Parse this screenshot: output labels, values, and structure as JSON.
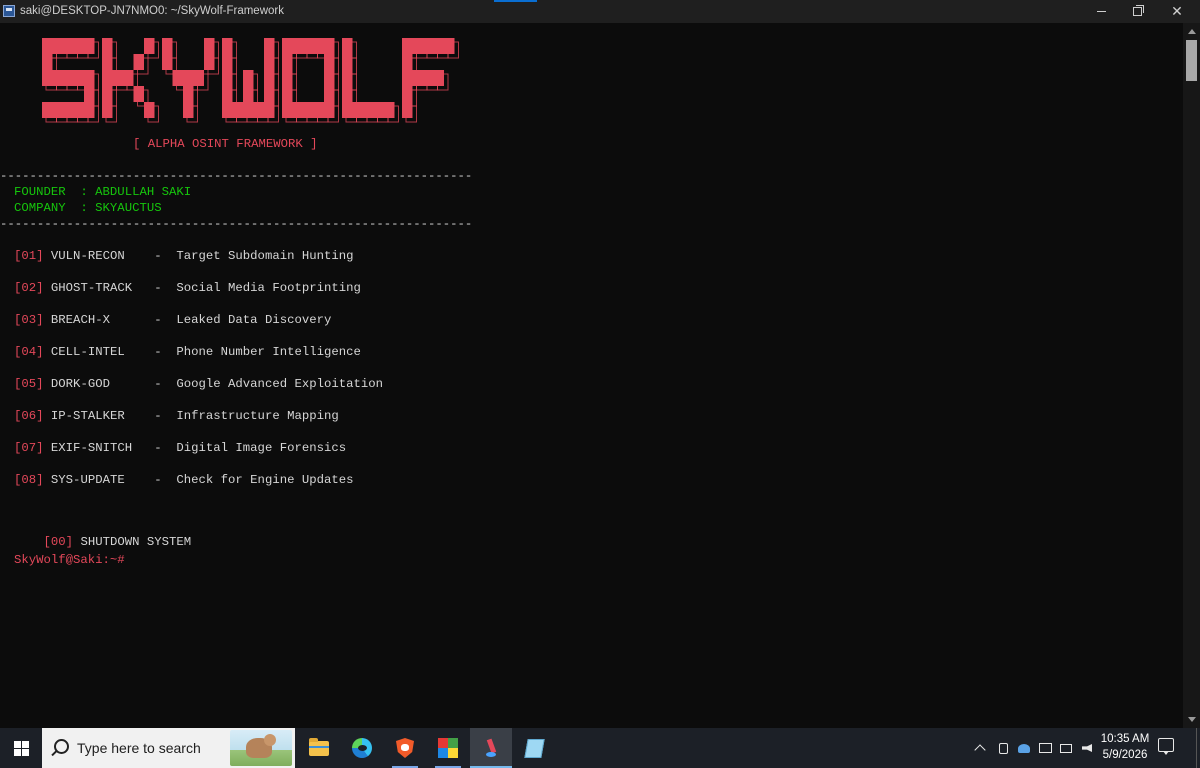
{
  "window": {
    "title": "saki@DESKTOP-JN7NMO0: ~/SkyWolf-Framework",
    "minimize_icon": "minimize-icon",
    "maximize_icon": "restore-icon",
    "close_icon": "close-icon",
    "close_glyph": "✕"
  },
  "banner": {
    "logo_text": "SKYWOLF",
    "logo_color": "#e4485a",
    "subtitle": "[ ALPHA OSINT FRAMEWORK ]"
  },
  "divider": "----------------------------------------------------------------",
  "info": {
    "founder": "FOUNDER  : ABDULLAH SAKI",
    "company": "COMPANY  : SKYAUCTUS"
  },
  "menu": [
    {
      "num": "[01]",
      "name": "VULN-RECON  ",
      "desc": "-  Target Subdomain Hunting"
    },
    {
      "num": "[02]",
      "name": "GHOST-TRACK ",
      "desc": "-  Social Media Footprinting"
    },
    {
      "num": "[03]",
      "name": "BREACH-X    ",
      "desc": "-  Leaked Data Discovery"
    },
    {
      "num": "[04]",
      "name": "CELL-INTEL  ",
      "desc": "-  Phone Number Intelligence"
    },
    {
      "num": "[05]",
      "name": "DORK-GOD    ",
      "desc": "-  Google Advanced Exploitation"
    },
    {
      "num": "[06]",
      "name": "IP-STALKER  ",
      "desc": "-  Infrastructure Mapping"
    },
    {
      "num": "[07]",
      "name": "EXIF-SNITCH ",
      "desc": "-  Digital Image Forensics"
    },
    {
      "num": "[08]",
      "name": "SYS-UPDATE  ",
      "desc": "-  Check for Engine Updates"
    }
  ],
  "shutdown": {
    "num": "[00]",
    "label": "SHUTDOWN SYSTEM"
  },
  "prompt": "SkyWolf@Saki:~#",
  "colors": {
    "background": "#0c0c0c",
    "accent_red": "#e4485a",
    "accent_green": "#16c60c",
    "text": "#d6d6d6"
  },
  "taskbar": {
    "search_placeholder": "Type here to search",
    "apps": [
      {
        "name": "file-explorer-icon"
      },
      {
        "name": "edge-icon"
      },
      {
        "name": "brave-icon"
      },
      {
        "name": "app-icon"
      },
      {
        "name": "terminal-icon",
        "active": true
      },
      {
        "name": "notepad-icon"
      }
    ],
    "time": "10:35 AM",
    "date": "5/9/2026"
  }
}
